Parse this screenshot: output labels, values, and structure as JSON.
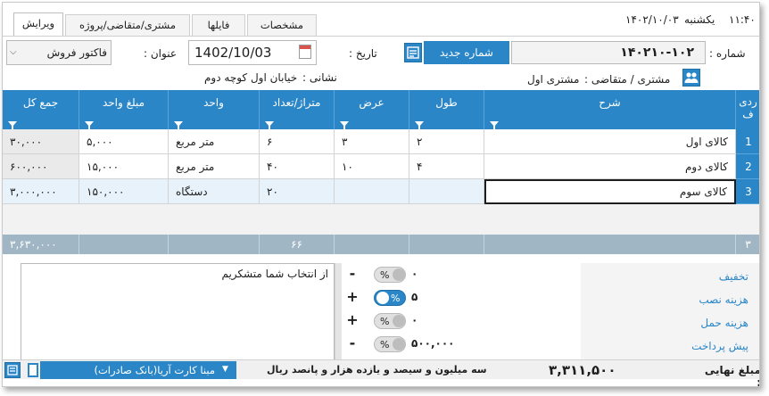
{
  "window": {
    "time": "۱۱:۴۰",
    "day": "یکشنبه",
    "date": "۱۴۰۲/۱۰/۰۳"
  },
  "tabs": [
    {
      "label": "ویرایش",
      "active": true
    },
    {
      "label": "مشتری/متقاضی/پروژه",
      "active": false
    },
    {
      "label": "فایلها",
      "active": false
    },
    {
      "label": "مشخصات",
      "active": false
    }
  ],
  "form": {
    "number_label": "شماره :",
    "number_value": "۱۴۰۲۱۰-۱۰۲",
    "new_number_button": "شماره جدید",
    "date_label": "تاریخ :",
    "date_value": "1402/10/03",
    "title_label": "عنوان :",
    "title_value": "فاکتور فروش",
    "customer_label": "مشتری / متقاضی :",
    "customer_value": "مشتری اول",
    "address_label": "نشانی :",
    "address_value": "خیابان اول کوچه دوم"
  },
  "grid": {
    "columns": {
      "row": "ردیف",
      "description": "شرح",
      "length": "طول",
      "width": "عرض",
      "area_qty": "متراژ/تعداد",
      "unit": "واحد",
      "unit_price": "مبلغ واحد",
      "total": "جمع کل"
    },
    "rows": [
      {
        "num": "1",
        "description": "کالای اول",
        "length": "۲",
        "width": "۳",
        "area_qty": "۶",
        "unit": "متر مربع",
        "unit_price": "۵,۰۰۰",
        "total": "۳۰,۰۰۰"
      },
      {
        "num": "2",
        "description": "کالای دوم",
        "length": "۴",
        "width": "۱۰",
        "area_qty": "۴۰",
        "unit": "متر مربع",
        "unit_price": "۱۵,۰۰۰",
        "total": "۶۰۰,۰۰۰"
      },
      {
        "num": "3",
        "description": "کالای سوم",
        "length": "",
        "width": "",
        "area_qty": "۲۰",
        "unit": "دستگاه",
        "unit_price": "۱۵۰,۰۰۰",
        "total": "۳,۰۰۰,۰۰۰"
      }
    ],
    "footer": {
      "row_count": "۳",
      "area_qty_sum": "۶۶",
      "total_sum": "۳,۶۳۰,۰۰۰"
    }
  },
  "note": {
    "text": "از انتخاب شما متشکریم"
  },
  "adjustments": [
    {
      "label": "تخفیف",
      "sign": "-",
      "percent_on": false,
      "amount": "۰"
    },
    {
      "label": "هزینه نصب",
      "sign": "+",
      "percent_on": true,
      "amount": "۵"
    },
    {
      "label": "هزینه حمل",
      "sign": "+",
      "percent_on": false,
      "amount": "۰"
    },
    {
      "label": "پیش پرداخت",
      "sign": "-",
      "percent_on": false,
      "amount": "۵۰۰,۰۰۰"
    }
  ],
  "percent_symbol": "%",
  "status": {
    "final_label": "مبلغ نهایی :",
    "final_value": "۳,۳۱۱,۵۰۰",
    "final_words": "سه میلیون و سیصد و یازده هزار و پانصد ریال",
    "account": "مبنا کارت آریا(بانک صادرات)"
  },
  "colors": {
    "accent": "#2a86c7",
    "total_row": "#a1b6c4",
    "selected_row": "#e8f2fb"
  }
}
